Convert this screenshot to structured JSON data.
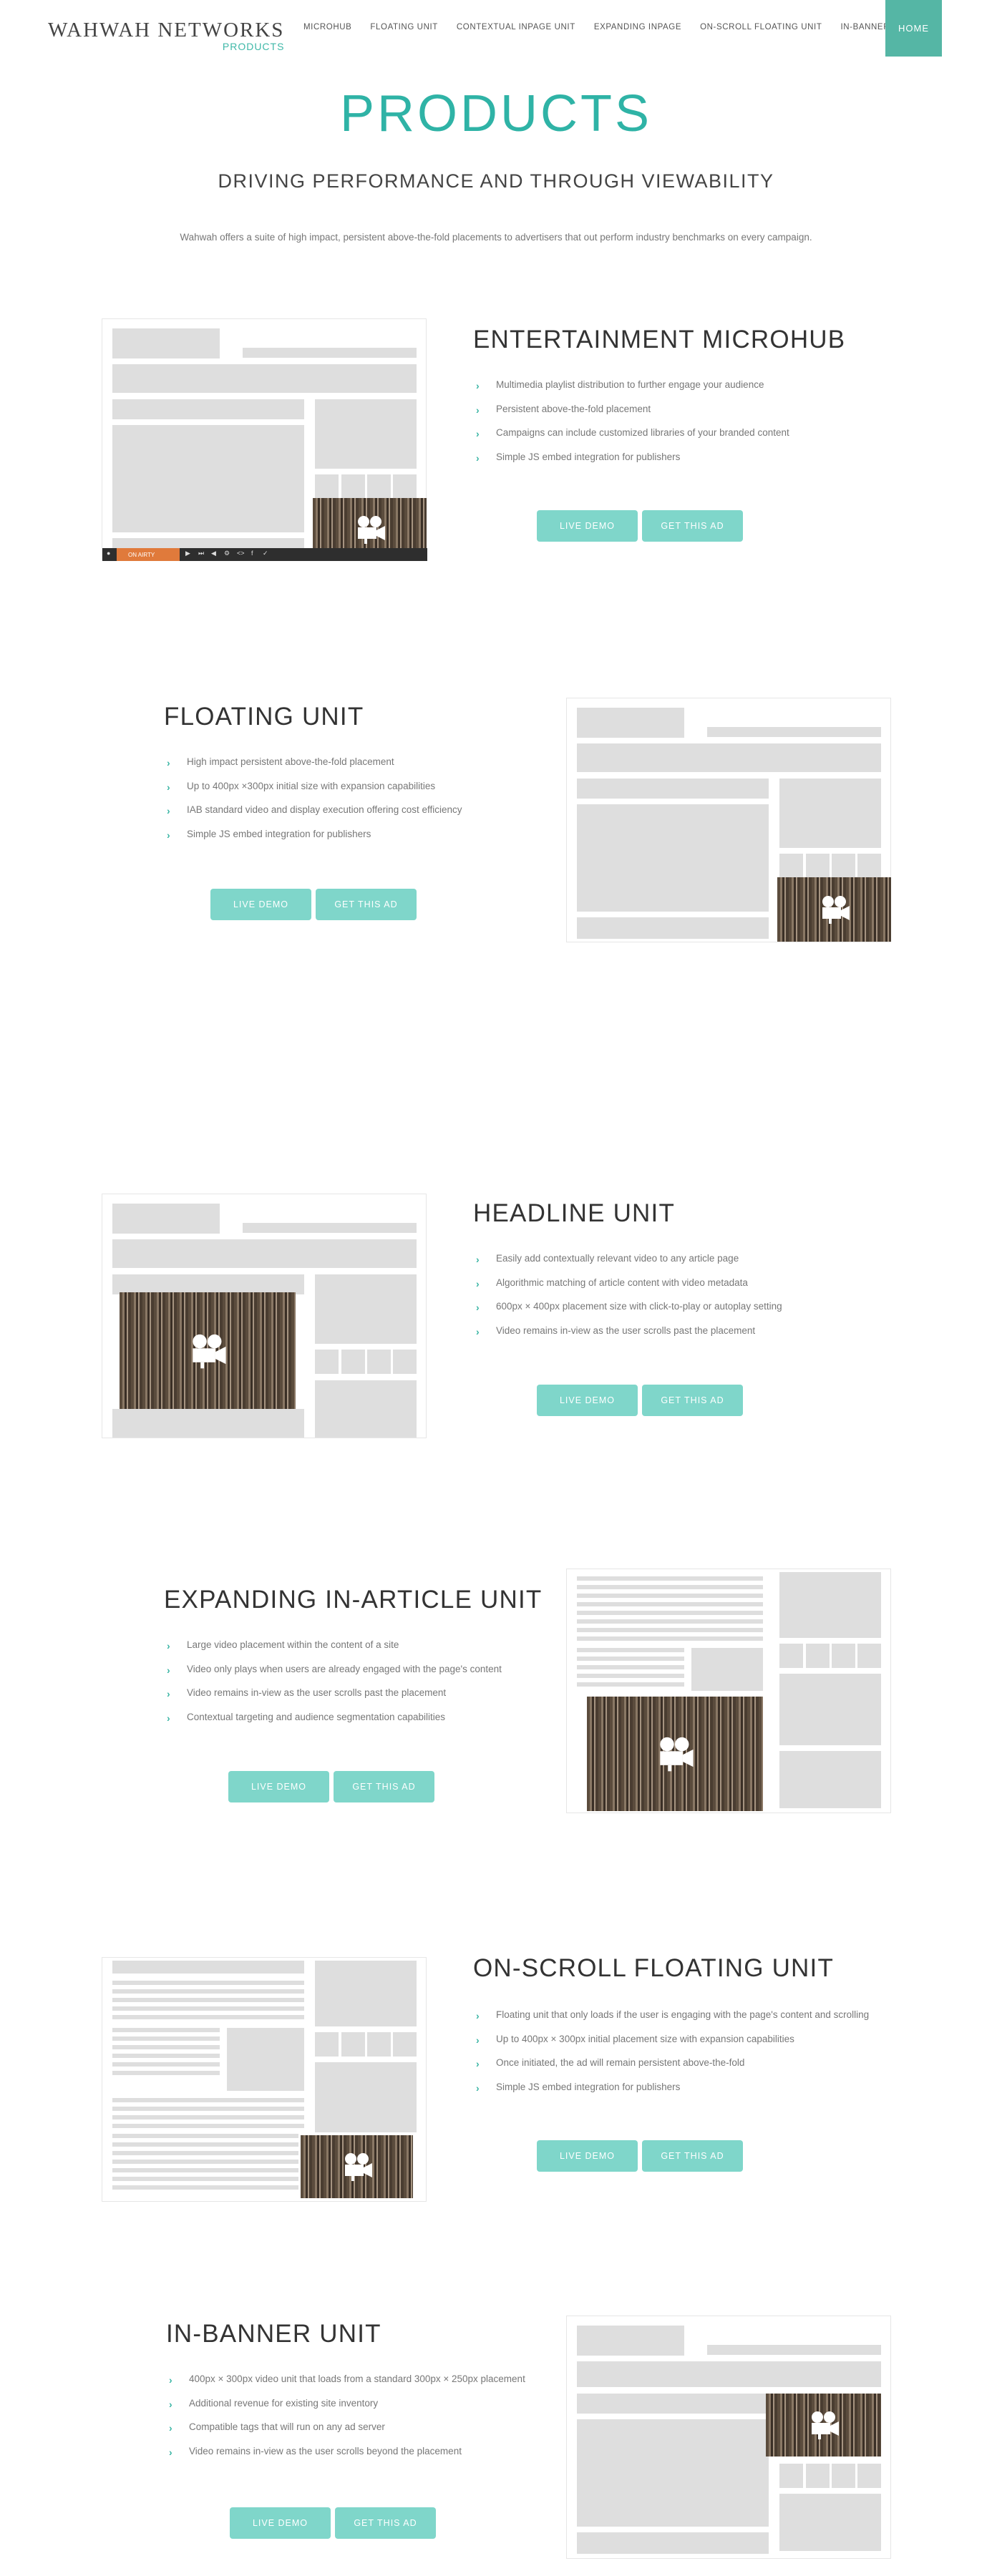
{
  "header": {
    "logo_main": "WAHWAH NETWORKS",
    "logo_sub": "PRODUCTS",
    "nav": [
      "MICROHUB",
      "FLOATING UNIT",
      "CONTEXTUAL INPAGE UNIT",
      "EXPANDING INPAGE",
      "ON-SCROLL FLOATING UNIT",
      "IN-BANNER UNIT"
    ],
    "home": "HOME"
  },
  "hero": {
    "title": "PRODUCTS",
    "subtitle": "DRIVING PERFORMANCE AND THROUGH VIEWABILITY",
    "description": "Wahwah offers a suite of high impact, persistent above-the-fold placements to advertisers that out perform industry benchmarks on every campaign."
  },
  "buttons": {
    "live_demo": "LIVE DEMO",
    "get_this_ad": "GET THIS AD"
  },
  "player_bar_label": "ON AIRTY",
  "sections": [
    {
      "title": "ENTERTAINMENT MICROHUB",
      "bullets": [
        "Multimedia playlist distribution to further engage your audience",
        "Persistent above-the-fold placement",
        "Campaigns can include customized libraries of your branded content",
        "Simple JS embed integration for publishers"
      ]
    },
    {
      "title": "FLOATING UNIT",
      "bullets": [
        "High impact persistent above-the-fold placement",
        "Up to 400px ×300px initial size with expansion capabilities",
        "IAB standard video and display execution offering cost efficiency",
        "Simple JS embed integration for publishers"
      ]
    },
    {
      "title": "HEADLINE UNIT",
      "bullets": [
        "Easily add contextually relevant video to any article page",
        "Algorithmic matching of article content with video metadata",
        "600px × 400px placement size with click-to-play or autoplay setting",
        "Video remains in-view as the user scrolls past the placement"
      ]
    },
    {
      "title": "EXPANDING IN-ARTICLE UNIT",
      "bullets": [
        "Large video placement within the content of a site",
        "Video only plays when users are already engaged with the page's content",
        "Video remains in-view as the user scrolls past the placement",
        "Contextual targeting and audience segmentation capabilities"
      ]
    },
    {
      "title": "ON-SCROLL FLOATING UNIT",
      "bullets": [
        "Floating unit that only loads if the user is engaging with the page's content and scrolling",
        "Up to 400px × 300px initial placement size with expansion capabilities",
        "Once initiated, the ad will remain persistent above-the-fold",
        "Simple JS embed integration for publishers"
      ]
    },
    {
      "title": "IN-BANNER UNIT",
      "bullets": [
        "400px × 300px video unit that loads from a standard 300px × 250px placement",
        "Additional revenue for existing site inventory",
        "Compatible tags that will run on any ad server",
        "Video remains in-view as the user scrolls beyond the placement"
      ]
    }
  ]
}
